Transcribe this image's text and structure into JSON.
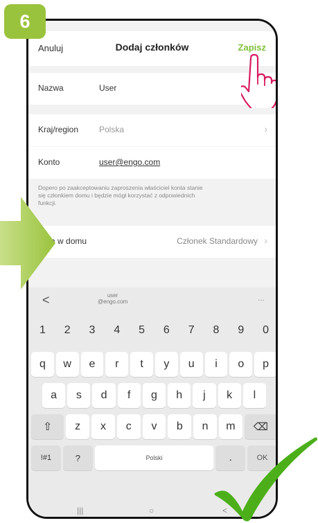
{
  "step": {
    "number": "6"
  },
  "header": {
    "cancel": "Anuluj",
    "title": "Dodaj członków",
    "save": "Zapisz"
  },
  "form": {
    "name": {
      "label": "Nazwa",
      "value": "User"
    },
    "region": {
      "label": "Kraj/region",
      "value": "Polska"
    },
    "account": {
      "label": "Konto",
      "value": "user@engo.com"
    },
    "note_lines": [
      "Dopero po zaakceptowaniu zaproszenia właściciel konta stanie",
      "się członkiem domu i będzie mógł korzystać z odpowiednich",
      "funkcji."
    ],
    "role": {
      "label": "Rola w domu",
      "value": "Członek Standardowy"
    }
  },
  "keyboard": {
    "back": "<",
    "suggestion": [
      "user",
      "@engo.com"
    ],
    "more": "...",
    "numbers": [
      "1",
      "2",
      "3",
      "4",
      "5",
      "6",
      "7",
      "8",
      "9",
      "0"
    ],
    "row1": [
      "q",
      "w",
      "e",
      "r",
      "t",
      "y",
      "u",
      "i",
      "o",
      "p"
    ],
    "row2": [
      "a",
      "s",
      "d",
      "f",
      "g",
      "h",
      "j",
      "k",
      "l"
    ],
    "row3": [
      "z",
      "x",
      "c",
      "v",
      "b",
      "n",
      "m"
    ],
    "shift": "⇧",
    "backspace": "⌫",
    "symbols": "!#1",
    "question": "?",
    "space": "Polski",
    "period": ".",
    "ok": "OK"
  },
  "navbar": {
    "recent": "|||",
    "home": "○",
    "back": "<"
  },
  "colors": {
    "accent": "#7fbf3a",
    "badge": "#9ac33d",
    "hand": "#d81b60",
    "check": "#4caf1a"
  },
  "icons": [
    "pointing-hand-icon",
    "checkmark-icon",
    "arrow-right-icon",
    "shift-icon",
    "backspace-icon",
    "chevron-right-icon"
  ]
}
